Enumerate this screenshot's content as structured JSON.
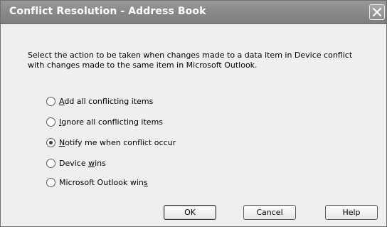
{
  "window": {
    "title": "Conflict Resolution - Address Book"
  },
  "description": "Select the action to be taken when changes made to a data item in Device conflict with changes made to the same item in Microsoft Outlook.",
  "options": [
    {
      "pre": "",
      "key": "A",
      "post": "dd all conflicting items",
      "checked": false
    },
    {
      "pre": "",
      "key": "I",
      "post": "gnore all conflicting items",
      "checked": false
    },
    {
      "pre": "",
      "key": "N",
      "post": "otify me when conflict occur",
      "checked": true
    },
    {
      "pre": "Device ",
      "key": "w",
      "post": "ins",
      "checked": false
    },
    {
      "pre": "Microsoft Outlook win",
      "key": "s",
      "post": "",
      "checked": false
    }
  ],
  "buttons": {
    "ok": "OK",
    "cancel": "Cancel",
    "help": "Help"
  },
  "icons": {
    "close": "close-icon"
  }
}
